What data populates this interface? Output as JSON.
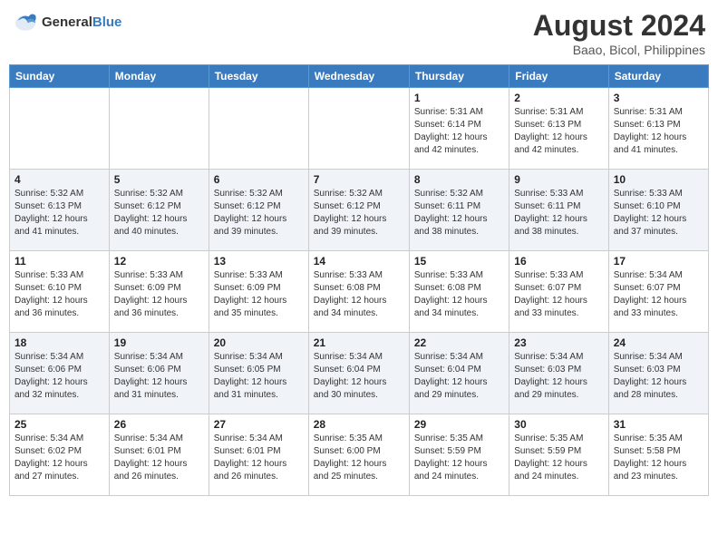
{
  "header": {
    "logo_line1": "General",
    "logo_line2": "Blue",
    "month_year": "August 2024",
    "location": "Baao, Bicol, Philippines"
  },
  "weekdays": [
    "Sunday",
    "Monday",
    "Tuesday",
    "Wednesday",
    "Thursday",
    "Friday",
    "Saturday"
  ],
  "weeks": [
    [
      {
        "day": "",
        "info": ""
      },
      {
        "day": "",
        "info": ""
      },
      {
        "day": "",
        "info": ""
      },
      {
        "day": "",
        "info": ""
      },
      {
        "day": "1",
        "info": "Sunrise: 5:31 AM\nSunset: 6:14 PM\nDaylight: 12 hours\nand 42 minutes."
      },
      {
        "day": "2",
        "info": "Sunrise: 5:31 AM\nSunset: 6:13 PM\nDaylight: 12 hours\nand 42 minutes."
      },
      {
        "day": "3",
        "info": "Sunrise: 5:31 AM\nSunset: 6:13 PM\nDaylight: 12 hours\nand 41 minutes."
      }
    ],
    [
      {
        "day": "4",
        "info": "Sunrise: 5:32 AM\nSunset: 6:13 PM\nDaylight: 12 hours\nand 41 minutes."
      },
      {
        "day": "5",
        "info": "Sunrise: 5:32 AM\nSunset: 6:12 PM\nDaylight: 12 hours\nand 40 minutes."
      },
      {
        "day": "6",
        "info": "Sunrise: 5:32 AM\nSunset: 6:12 PM\nDaylight: 12 hours\nand 39 minutes."
      },
      {
        "day": "7",
        "info": "Sunrise: 5:32 AM\nSunset: 6:12 PM\nDaylight: 12 hours\nand 39 minutes."
      },
      {
        "day": "8",
        "info": "Sunrise: 5:32 AM\nSunset: 6:11 PM\nDaylight: 12 hours\nand 38 minutes."
      },
      {
        "day": "9",
        "info": "Sunrise: 5:33 AM\nSunset: 6:11 PM\nDaylight: 12 hours\nand 38 minutes."
      },
      {
        "day": "10",
        "info": "Sunrise: 5:33 AM\nSunset: 6:10 PM\nDaylight: 12 hours\nand 37 minutes."
      }
    ],
    [
      {
        "day": "11",
        "info": "Sunrise: 5:33 AM\nSunset: 6:10 PM\nDaylight: 12 hours\nand 36 minutes."
      },
      {
        "day": "12",
        "info": "Sunrise: 5:33 AM\nSunset: 6:09 PM\nDaylight: 12 hours\nand 36 minutes."
      },
      {
        "day": "13",
        "info": "Sunrise: 5:33 AM\nSunset: 6:09 PM\nDaylight: 12 hours\nand 35 minutes."
      },
      {
        "day": "14",
        "info": "Sunrise: 5:33 AM\nSunset: 6:08 PM\nDaylight: 12 hours\nand 34 minutes."
      },
      {
        "day": "15",
        "info": "Sunrise: 5:33 AM\nSunset: 6:08 PM\nDaylight: 12 hours\nand 34 minutes."
      },
      {
        "day": "16",
        "info": "Sunrise: 5:33 AM\nSunset: 6:07 PM\nDaylight: 12 hours\nand 33 minutes."
      },
      {
        "day": "17",
        "info": "Sunrise: 5:34 AM\nSunset: 6:07 PM\nDaylight: 12 hours\nand 33 minutes."
      }
    ],
    [
      {
        "day": "18",
        "info": "Sunrise: 5:34 AM\nSunset: 6:06 PM\nDaylight: 12 hours\nand 32 minutes."
      },
      {
        "day": "19",
        "info": "Sunrise: 5:34 AM\nSunset: 6:06 PM\nDaylight: 12 hours\nand 31 minutes."
      },
      {
        "day": "20",
        "info": "Sunrise: 5:34 AM\nSunset: 6:05 PM\nDaylight: 12 hours\nand 31 minutes."
      },
      {
        "day": "21",
        "info": "Sunrise: 5:34 AM\nSunset: 6:04 PM\nDaylight: 12 hours\nand 30 minutes."
      },
      {
        "day": "22",
        "info": "Sunrise: 5:34 AM\nSunset: 6:04 PM\nDaylight: 12 hours\nand 29 minutes."
      },
      {
        "day": "23",
        "info": "Sunrise: 5:34 AM\nSunset: 6:03 PM\nDaylight: 12 hours\nand 29 minutes."
      },
      {
        "day": "24",
        "info": "Sunrise: 5:34 AM\nSunset: 6:03 PM\nDaylight: 12 hours\nand 28 minutes."
      }
    ],
    [
      {
        "day": "25",
        "info": "Sunrise: 5:34 AM\nSunset: 6:02 PM\nDaylight: 12 hours\nand 27 minutes."
      },
      {
        "day": "26",
        "info": "Sunrise: 5:34 AM\nSunset: 6:01 PM\nDaylight: 12 hours\nand 26 minutes."
      },
      {
        "day": "27",
        "info": "Sunrise: 5:34 AM\nSunset: 6:01 PM\nDaylight: 12 hours\nand 26 minutes."
      },
      {
        "day": "28",
        "info": "Sunrise: 5:35 AM\nSunset: 6:00 PM\nDaylight: 12 hours\nand 25 minutes."
      },
      {
        "day": "29",
        "info": "Sunrise: 5:35 AM\nSunset: 5:59 PM\nDaylight: 12 hours\nand 24 minutes."
      },
      {
        "day": "30",
        "info": "Sunrise: 5:35 AM\nSunset: 5:59 PM\nDaylight: 12 hours\nand 24 minutes."
      },
      {
        "day": "31",
        "info": "Sunrise: 5:35 AM\nSunset: 5:58 PM\nDaylight: 12 hours\nand 23 minutes."
      }
    ]
  ]
}
